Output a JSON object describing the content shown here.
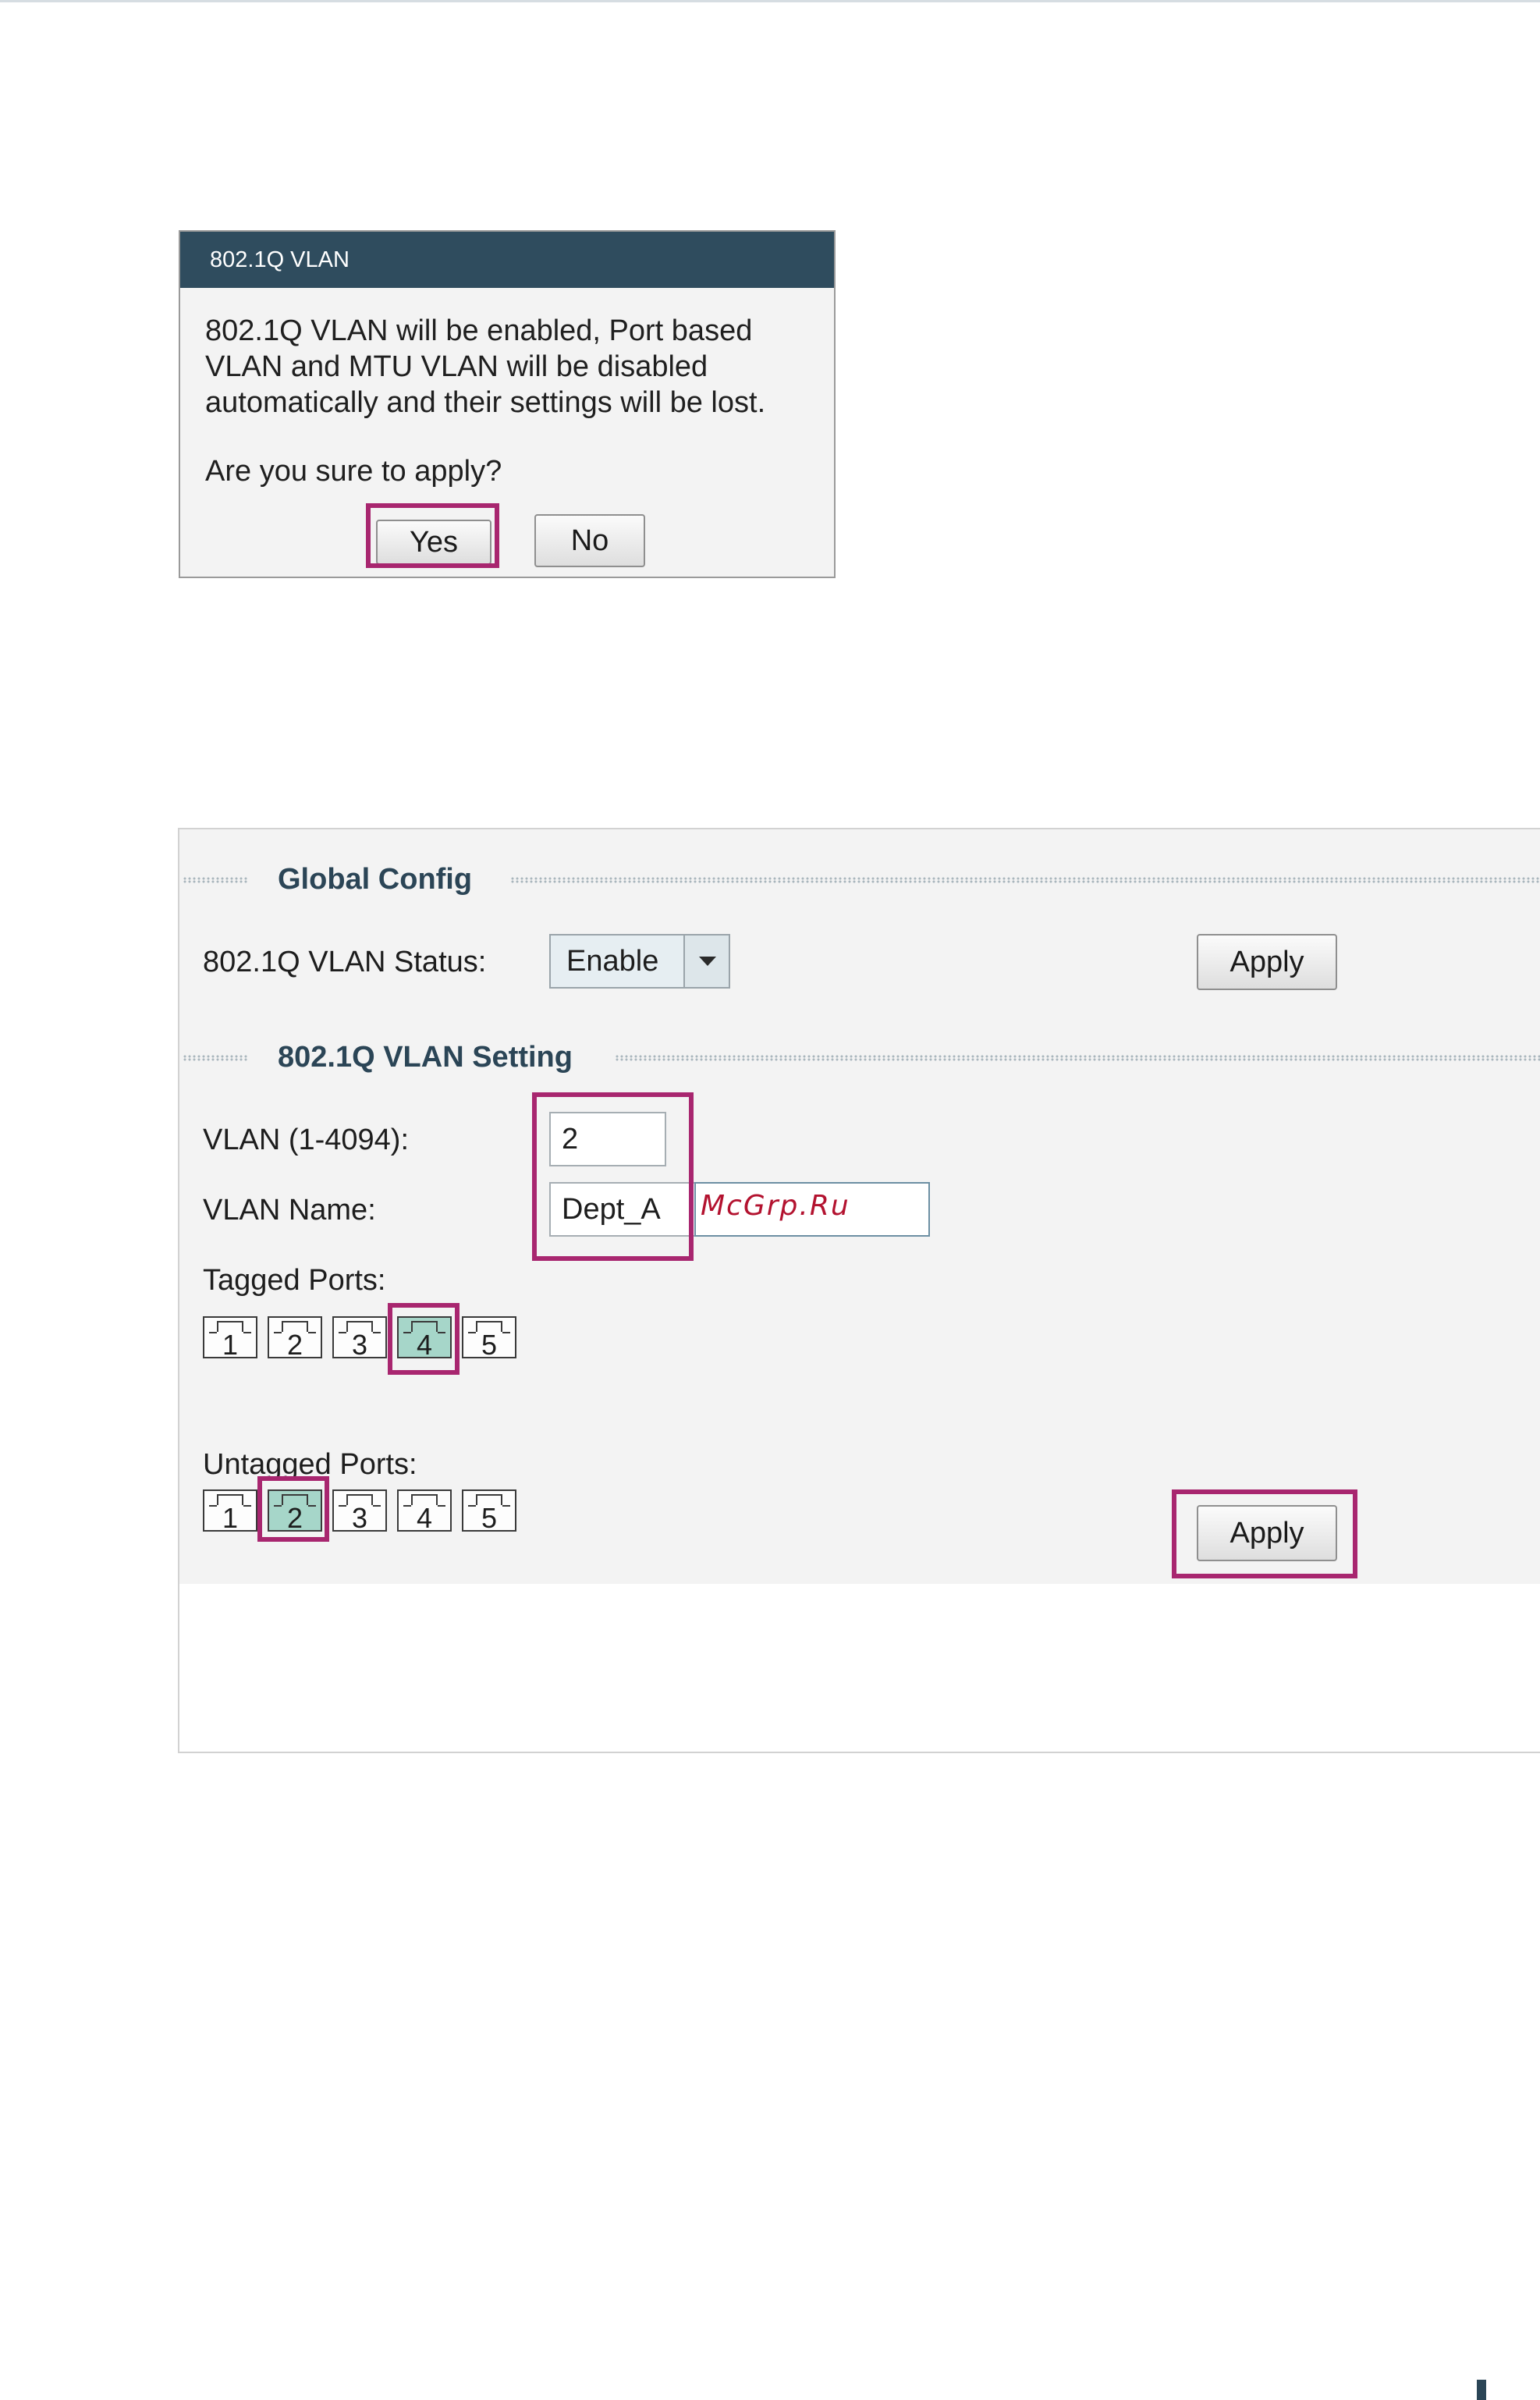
{
  "dialog": {
    "title": "802.1Q VLAN",
    "message_lines": [
      "802.1Q VLAN will be enabled, Port based",
      "VLAN and MTU VLAN will be disabled",
      "automatically and their settings will be lost."
    ],
    "question": "Are you sure to apply?",
    "yes_label": "Yes",
    "no_label": "No"
  },
  "global_config": {
    "heading": "Global Config",
    "status_label": "802.1Q VLAN Status:",
    "status_value": "Enable",
    "apply_label": "Apply"
  },
  "vlan_setting": {
    "heading": "802.1Q VLAN Setting",
    "vlan_id_label": "VLAN (1-4094):",
    "vlan_id_value": "2",
    "vlan_name_label": "VLAN Name:",
    "vlan_name_value": "Dept_A",
    "watermark": "McGrp.Ru",
    "tagged_label": "Tagged Ports:",
    "untagged_label": "Untagged Ports:",
    "ports": [
      "1",
      "2",
      "3",
      "4",
      "5"
    ],
    "tagged_selected": [
      "4"
    ],
    "untagged_selected": [
      "2"
    ],
    "apply_label": "Apply"
  },
  "colors": {
    "highlight": "#a8266f",
    "dialog_header": "#2f4c5e",
    "selected_port": "#a6d6c9",
    "section_title": "#2b4556"
  }
}
